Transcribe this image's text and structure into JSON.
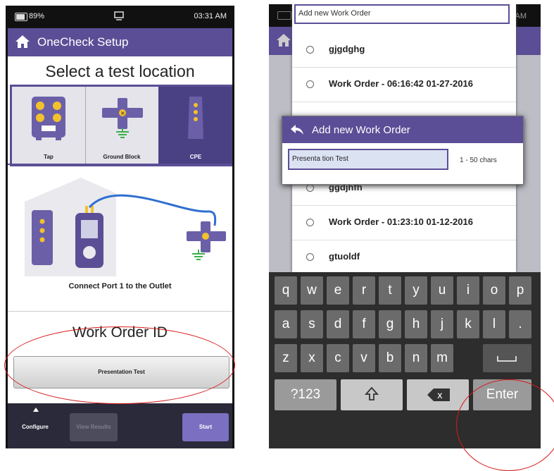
{
  "left": {
    "status": {
      "battery": "89%",
      "time": "03:31 AM"
    },
    "title": "OneCheck Setup",
    "heading": "Select a test location",
    "locations": [
      {
        "label": "Tap"
      },
      {
        "label": "Ground Block"
      },
      {
        "label": "CPE",
        "selected": true
      }
    ],
    "instruction": "Connect Port 1 to the Outlet",
    "work_order_label": "Work Order ID",
    "work_order_value": "Presentation Test",
    "bottom": {
      "configure": "Configure",
      "view_results": "View Results",
      "start": "Start"
    }
  },
  "right": {
    "status": {
      "time": "AM"
    },
    "list_header": "Add new Work Order",
    "rows_top": [
      "gjgdghg",
      "Work Order - 06:16:42 01-27-2016"
    ],
    "dialog": {
      "title": "Add new Work Order",
      "input": "Presenta tion Test",
      "hint": "1 - 50 chars"
    },
    "rows_bottom": [
      "ggdjhfh",
      "Work Order - 01:23:10 01-12-2016",
      "gtuoldf"
    ],
    "keyboard": {
      "row1": [
        "q",
        "w",
        "e",
        "r",
        "t",
        "y",
        "u",
        "i",
        "o",
        "p"
      ],
      "row2": [
        "a",
        "s",
        "d",
        "f",
        "g",
        "h",
        "j",
        "k",
        "l",
        "."
      ],
      "row3": [
        "z",
        "x",
        "c",
        "v",
        "b",
        "n",
        "m"
      ],
      "sym": "?123",
      "enter": "Enter"
    }
  },
  "colors": {
    "accent": "#5b4e96",
    "highlight": "#d81a1a"
  },
  "icons": [
    "home-icon",
    "back-arrow-icon",
    "shift-icon",
    "backspace-icon",
    "battery-icon",
    "notification-icon"
  ]
}
